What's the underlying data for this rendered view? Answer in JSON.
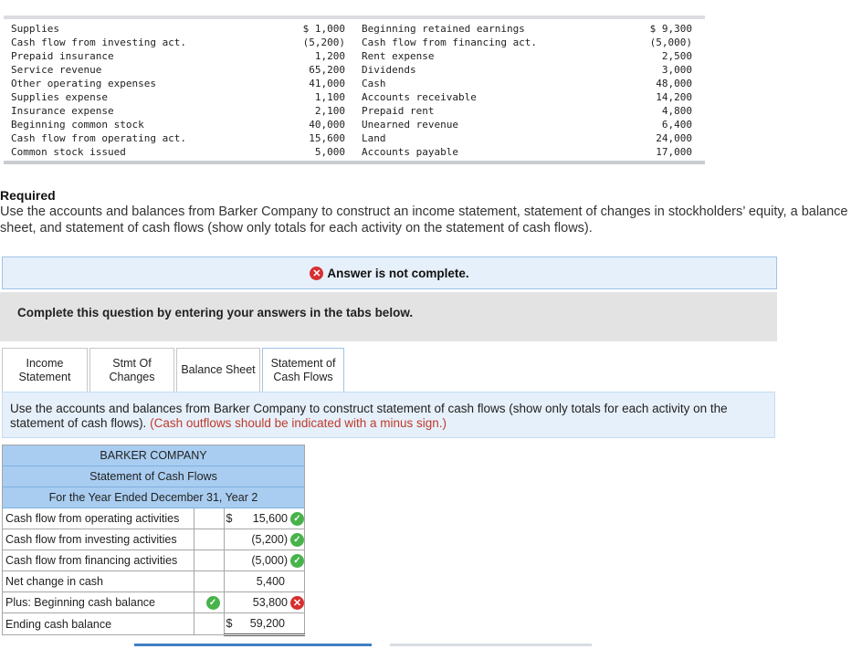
{
  "accounts": [
    {
      "name1": "Supplies",
      "val1": "$ 1,000",
      "name2": "Beginning retained earnings",
      "val2": "$ 9,300"
    },
    {
      "name1": "Cash flow from investing act.",
      "val1": "(5,200)",
      "name2": "Cash flow from financing act.",
      "val2": "(5,000)"
    },
    {
      "name1": "Prepaid insurance",
      "val1": "1,200",
      "name2": "Rent expense",
      "val2": "2,500"
    },
    {
      "name1": "Service revenue",
      "val1": "65,200",
      "name2": "Dividends",
      "val2": "3,000"
    },
    {
      "name1": "Other operating expenses",
      "val1": "41,000",
      "name2": "Cash",
      "val2": "48,000"
    },
    {
      "name1": "Supplies expense",
      "val1": "1,100",
      "name2": "Accounts receivable",
      "val2": "14,200"
    },
    {
      "name1": "Insurance expense",
      "val1": "2,100",
      "name2": "Prepaid rent",
      "val2": "4,800"
    },
    {
      "name1": "Beginning common stock",
      "val1": "40,000",
      "name2": "Unearned revenue",
      "val2": "6,400"
    },
    {
      "name1": "Cash flow from operating act.",
      "val1": "15,600",
      "name2": "Land",
      "val2": "24,000"
    },
    {
      "name1": "Common stock issued",
      "val1": "5,000",
      "name2": "Accounts payable",
      "val2": "17,000"
    }
  ],
  "required": {
    "title": "Required",
    "text": "Use the accounts and balances from Barker Company to construct an income statement, statement of changes in stockholders’ equity, a balance sheet, and statement of cash flows (show only totals for each activity on the statement of cash flows)."
  },
  "status": {
    "text": "Answer is not complete."
  },
  "instruction": {
    "text": "Complete this question by entering your answers in the tabs below."
  },
  "tabs": [
    {
      "line1": "Income",
      "line2": "Statement"
    },
    {
      "line1": "Stmt Of",
      "line2": "Changes"
    },
    {
      "line1": "Balance Sheet",
      "line2": ""
    },
    {
      "line1": "Statement of",
      "line2": "Cash Flows"
    }
  ],
  "tab_instruction": {
    "text": "Use the accounts and balances from Barker Company to construct statement of cash flows (show only totals for each activity on the statement of cash flows).",
    "note": "(Cash outflows should be indicated with a minus sign.)"
  },
  "cash_flow": {
    "company": "BARKER COMPANY",
    "title": "Statement of Cash Flows",
    "period": "For the Year Ended December 31, Year 2",
    "rows": [
      {
        "label": "Cash flow from operating activities",
        "dollar": "$",
        "value": "15,600",
        "status": "correct"
      },
      {
        "label": "Cash flow from investing activities",
        "dollar": "",
        "value": "(5,200)",
        "status": "correct"
      },
      {
        "label": "Cash flow from financing activities",
        "dollar": "",
        "value": "(5,000)",
        "status": "correct"
      },
      {
        "label": "Net change in cash",
        "dollar": "",
        "value": "5,400",
        "status": ""
      },
      {
        "label": "Plus: Beginning cash balance",
        "dollar": "",
        "value": "53,800",
        "status": "incorrect",
        "label_status": "correct"
      },
      {
        "label": "Ending cash balance",
        "dollar": "$",
        "value": "59,200",
        "status": ""
      }
    ]
  },
  "colors": {
    "header_blue": "#a9cdf0",
    "correct": "#47b34a",
    "incorrect": "#d63031",
    "note_red": "#c0392b"
  }
}
